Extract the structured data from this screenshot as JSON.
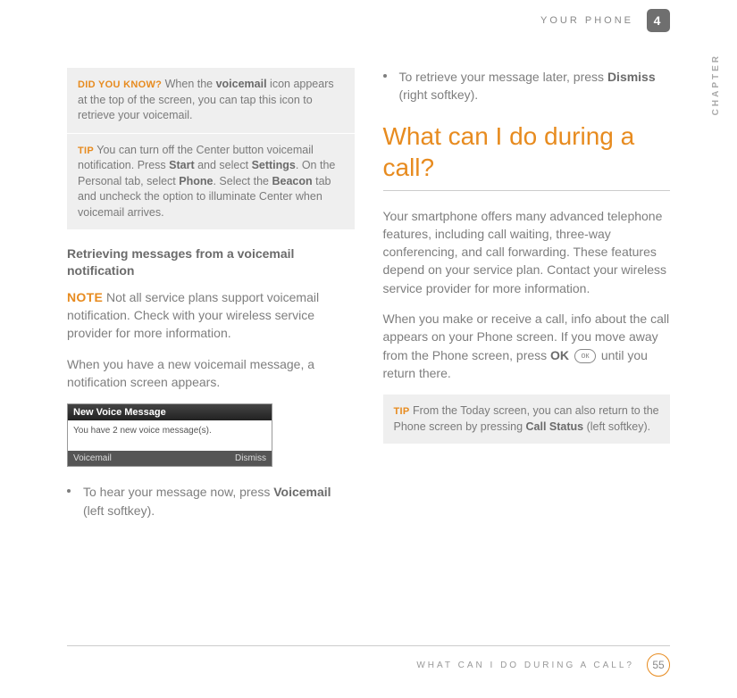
{
  "header": {
    "title": "YOUR PHONE",
    "chapter_num": "4"
  },
  "side": {
    "label": "CHAPTER"
  },
  "left": {
    "dyn_label": "DID YOU KNOW?",
    "dyn_text_a": " When the ",
    "dyn_bold_a": "voicemail",
    "dyn_text_b": " icon appears at the top of the screen, you can tap this icon to retrieve your voicemail.",
    "tip_label": "TIP",
    "tip_text_a": " You can turn off the Center button voicemail notification. Press ",
    "tip_bold_a": "Start",
    "tip_text_b": " and select ",
    "tip_bold_b": "Settings",
    "tip_text_c": ". On the Personal tab, select ",
    "tip_bold_c": "Phone",
    "tip_text_d": ". Select the ",
    "tip_bold_d": "Beacon",
    "tip_text_e": " tab and uncheck the option to illuminate Center when voicemail arrives.",
    "subhead": "Retrieving messages from a voicemail notification",
    "note_label": "NOTE",
    "note_text": " Not all service plans support voicemail notification. Check with your wireless service provider for more information.",
    "para1": "When you have a new voicemail message, a notification screen appears.",
    "ss_title": "New Voice Message",
    "ss_body": "You have 2 new voice message(s).",
    "ss_left": "Voicemail",
    "ss_right": "Dismiss",
    "b1_a": "To hear your message now, press ",
    "b1_bold": "Voicemail",
    "b1_b": " (left softkey)."
  },
  "right": {
    "b1_a": "To retrieve your message later, press ",
    "b1_bold": "Dismiss",
    "b1_b": " (right softkey).",
    "section_title": "What can I do during a call?",
    "p1": "Your smartphone offers many advanced telephone features, including call waiting, three-way conferencing, and call forwarding. These features depend on your service plan. Contact your wireless service provider for more information.",
    "p2_a": "When you make or receive a call, info about the call appears on your Phone screen. If you move away from the Phone screen, press ",
    "p2_bold": "OK",
    "p2_b": " until you return there.",
    "ok_icon_text": "ок",
    "tip_label": "TIP",
    "tip_text_a": " From the Today screen, you can also return to the Phone screen by pressing ",
    "tip_bold": "Call Status",
    "tip_text_b": " (left softkey)."
  },
  "footer": {
    "title": "WHAT CAN I DO DURING A CALL?",
    "page": "55"
  }
}
